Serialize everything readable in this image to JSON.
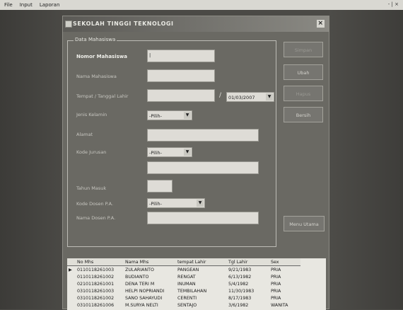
{
  "menu": {
    "items": [
      "File",
      "Input",
      "Laporan"
    ],
    "window_controls": "- | ×"
  },
  "dialog": {
    "title": "SEKOLAH TINGGI TEKNOLOGI",
    "close_label": "×",
    "group_label": "Data Mahasiswa"
  },
  "form": {
    "nomor_label": "Nomor Mahasiswa",
    "nomor_value": "|",
    "nama_label": "Nama Mahasiswa",
    "nama_value": "",
    "tempat_label": "Tempat / Tanggal Lahir",
    "tempat_value": "",
    "slash": "/",
    "tanggal_value": "01/03/2007",
    "jk_label": "Jenis Kelamin",
    "jk_value": "-Pilih-",
    "alamat_label": "Alamat",
    "alamat_value": "",
    "jurusan_label": "Kode Jurusan",
    "jurusan_value": "-Pilih-",
    "jurusan_nama_value": "",
    "tahun_label": "Tahun Masuk",
    "tahun_value": "",
    "dosen_label": "Kode Dosen P.A.",
    "dosen_value": "-Pilih-",
    "nama_dosen_label": "Nama Dosen P.A.",
    "nama_dosen_value": ""
  },
  "buttons": {
    "simpan": "Simpan",
    "ubah": "Ubah",
    "hapus": "Hapus",
    "bersih": "Bersih",
    "menu_utama": "Menu Utama"
  },
  "table": {
    "headers": [
      "No Mhs",
      "Nama Mhs",
      "tempat Lahir",
      "Tgl Lahir",
      "Sex"
    ],
    "rows": [
      [
        "0110118261003",
        "ZULARIANTO",
        "PANGEAN",
        "9/21/1983",
        "PRIA"
      ],
      [
        "0110118261002",
        "BUDIANTO",
        "RENGAT",
        "6/13/1982",
        "PRIA"
      ],
      [
        "0210118261001",
        "DENA TERI M",
        "INUMAN",
        "5/4/1982",
        "PRIA"
      ],
      [
        "0310118261003",
        "HELPI NOPRIANDI",
        "TEMBILAHAN",
        "11/30/1983",
        "PRIA"
      ],
      [
        "0310118261002",
        "SANO SAHAYUDI",
        "CERENTI",
        "8/17/1983",
        "PRIA"
      ],
      [
        "0310118261006",
        "M.SURYA NELTI",
        "SENTAJO",
        "3/6/1982",
        "WANITA"
      ]
    ],
    "selected_row": 0,
    "row_pointer": "▶"
  }
}
